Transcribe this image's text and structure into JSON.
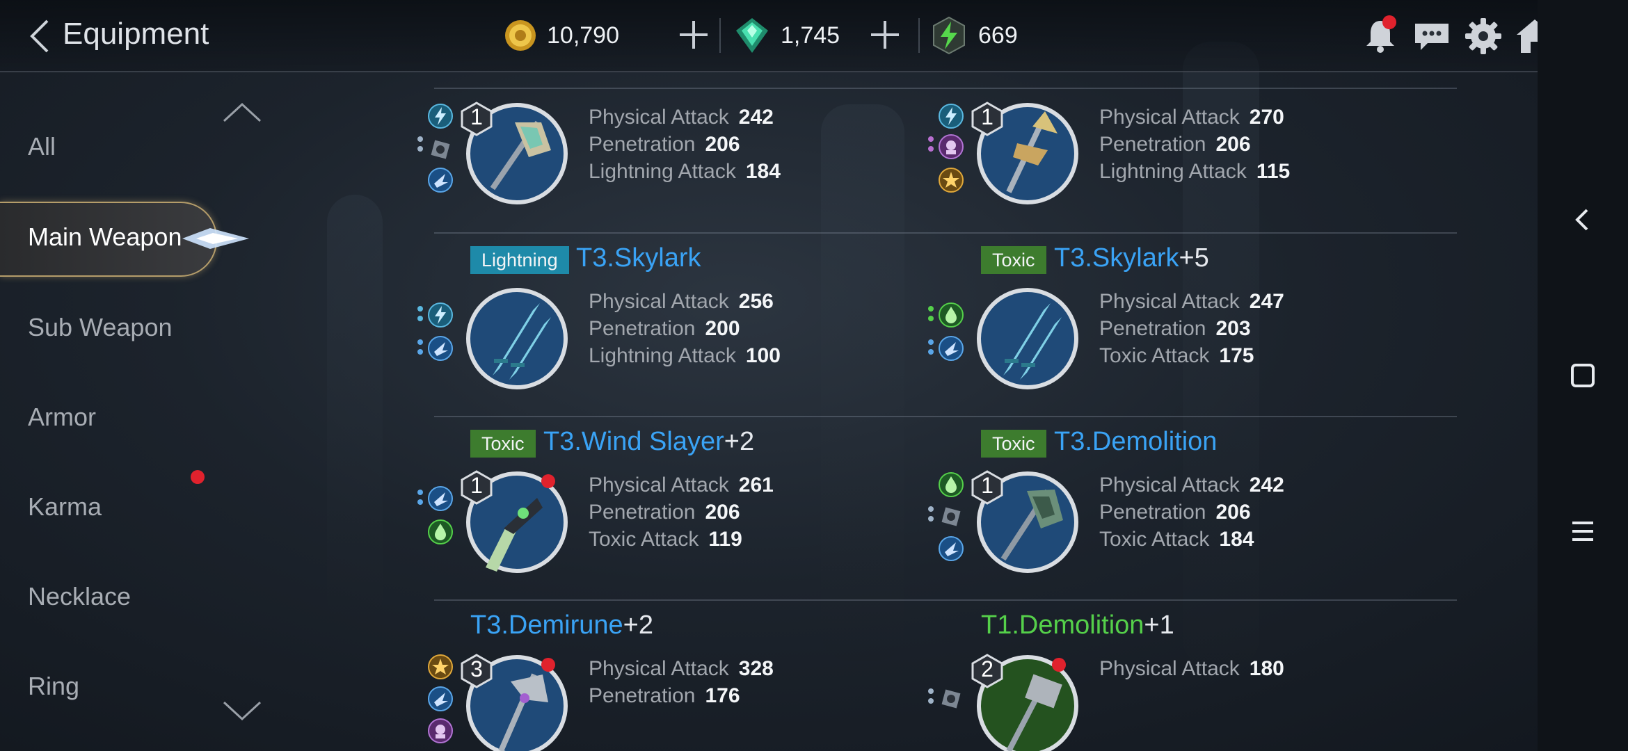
{
  "header": {
    "title": "Equipment",
    "currencies": [
      {
        "name": "gold",
        "value": "10,790",
        "icon": "gold-coin-icon",
        "color": "#e0b53c"
      },
      {
        "name": "gem",
        "value": "1,745",
        "icon": "green-crystal-icon",
        "color": "#3fd6a0"
      },
      {
        "name": "energy",
        "value": "669",
        "icon": "lightning-energy-icon",
        "color": "#4fd04a"
      }
    ],
    "icons": [
      "notification-bell-icon",
      "chat-icon",
      "settings-gear-icon",
      "home-icon",
      "signal-icon",
      "battery-icon"
    ]
  },
  "sidebar": {
    "categories": [
      {
        "label": "All",
        "active": false
      },
      {
        "label": "Main Weapon",
        "active": true
      },
      {
        "label": "Sub Weapon",
        "active": false
      },
      {
        "label": "Armor",
        "active": false
      },
      {
        "label": "Karma",
        "active": false,
        "notification": true
      },
      {
        "label": "Necklace",
        "active": false
      },
      {
        "label": "Ring",
        "active": false
      }
    ]
  },
  "items": [
    {
      "tag": "",
      "name": "",
      "plus": "",
      "level": "1",
      "new": false,
      "stats": [
        {
          "label": "Physical Attack",
          "value": "242"
        },
        {
          "label": "Penetration",
          "value": "206"
        },
        {
          "label": "Lightning Attack",
          "value": "184"
        }
      ]
    },
    {
      "tag": "",
      "name": "",
      "plus": "",
      "level": "1",
      "new": false,
      "stats": [
        {
          "label": "Physical Attack",
          "value": "270"
        },
        {
          "label": "Penetration",
          "value": "206"
        },
        {
          "label": "Lightning Attack",
          "value": "115"
        }
      ]
    },
    {
      "tag": "Lightning",
      "name": "T3.Skylark",
      "plus": "",
      "level": "",
      "new": false,
      "stats": [
        {
          "label": "Physical Attack",
          "value": "256"
        },
        {
          "label": "Penetration",
          "value": "200"
        },
        {
          "label": "Lightning Attack",
          "value": "100"
        }
      ]
    },
    {
      "tag": "Toxic",
      "name": "T3.Skylark",
      "plus": "+5",
      "level": "",
      "new": false,
      "stats": [
        {
          "label": "Physical Attack",
          "value": "247"
        },
        {
          "label": "Penetration",
          "value": "203"
        },
        {
          "label": "Toxic Attack",
          "value": "175"
        }
      ]
    },
    {
      "tag": "Toxic",
      "name": "T3.Wind Slayer",
      "plus": "+2",
      "level": "1",
      "new": true,
      "stats": [
        {
          "label": "Physical Attack",
          "value": "261"
        },
        {
          "label": "Penetration",
          "value": "206"
        },
        {
          "label": "Toxic Attack",
          "value": "119"
        }
      ]
    },
    {
      "tag": "Toxic",
      "name": "T3.Demolition",
      "plus": "",
      "level": "1",
      "new": false,
      "stats": [
        {
          "label": "Physical Attack",
          "value": "242"
        },
        {
          "label": "Penetration",
          "value": "206"
        },
        {
          "label": "Toxic Attack",
          "value": "184"
        }
      ]
    },
    {
      "tag": "",
      "name": "T3.Demirune",
      "plus": "+2",
      "level": "3",
      "new": true,
      "stats": [
        {
          "label": "Physical Attack",
          "value": "328"
        },
        {
          "label": "Penetration",
          "value": "176"
        }
      ]
    },
    {
      "tag": "",
      "name": "T1.Demolition",
      "plus": "+1",
      "level": "2",
      "new": true,
      "name_color": "#55d04a",
      "stats": [
        {
          "label": "Physical Attack",
          "value": "180"
        }
      ]
    }
  ]
}
